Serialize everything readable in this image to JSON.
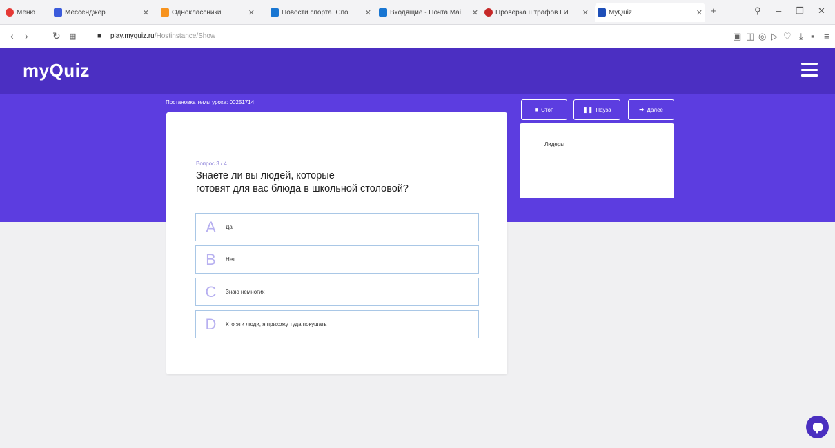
{
  "browser": {
    "tabs": [
      {
        "label": "Меню",
        "color": "#e53935"
      },
      {
        "label": "Мессенджер",
        "color": "#3b5bdb"
      },
      {
        "label": "Одноклассники",
        "color": "#f7931e"
      },
      {
        "label": "Новости спорта. Спо",
        "color": "#1976d2"
      },
      {
        "label": "Входящие - Почта Mai",
        "color": "#1976d2"
      },
      {
        "label": "Проверка штрафов ГИ",
        "color": "#c62828"
      },
      {
        "label": "MyQuiz",
        "color": "#1e4fb8"
      }
    ],
    "url_domain": "play.myquiz.ru",
    "url_path": "/Hostinstance/Show"
  },
  "header": {
    "logo": "myQuiz"
  },
  "lesson": {
    "title": "Постановка темы урока: 00251714"
  },
  "question": {
    "number": "Вопрос 3 / 4",
    "text_line1": "Знаете ли вы людей, которые",
    "text_line2": "готовят для вас блюда в школьной столовой?"
  },
  "answers": [
    {
      "letter": "A",
      "text": "Да"
    },
    {
      "letter": "B",
      "text": "Нет"
    },
    {
      "letter": "C",
      "text": "Знаю немногих"
    },
    {
      "letter": "D",
      "text": "Кто эти люди, я прихожу туда покушать"
    }
  ],
  "controls": {
    "stop": "Стоп",
    "pause": "Пауза",
    "next": "Далее"
  },
  "leaders": {
    "title": "Лидеры"
  }
}
